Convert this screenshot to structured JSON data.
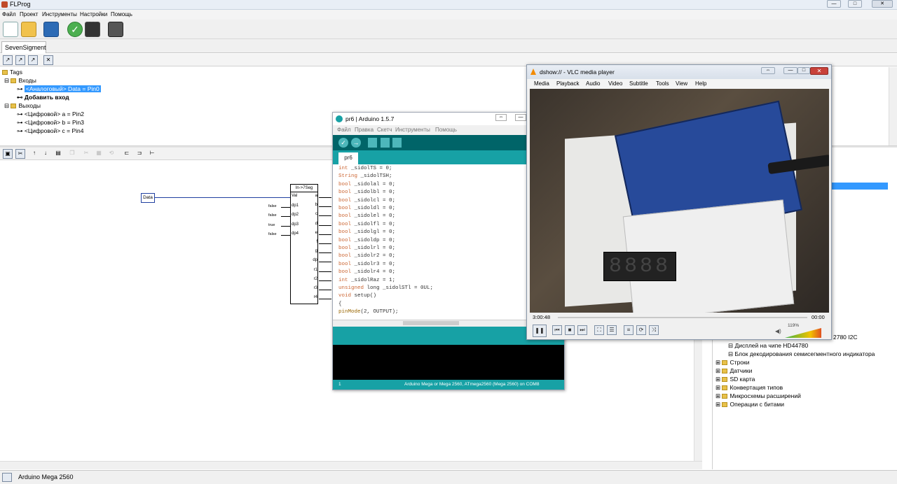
{
  "app": {
    "title": "FLProg",
    "menu": [
      "Файл",
      "Проект",
      "Инструменты",
      "Настройки",
      "Помощь"
    ],
    "tab": "SevenSigment",
    "status": "Arduino Mega 2560"
  },
  "tree": {
    "root": "Tags",
    "inputs_label": "Входы",
    "input_item": "<Аналоговый> Data = Pin0",
    "add_input": "Добавить вход",
    "outputs_label": "Выходы",
    "outputs": [
      "<Цифровой> a = Pin2",
      "<Цифровой> b = Pin3",
      "<Цифровой> c = Pin4"
    ]
  },
  "diagram": {
    "data_block": "Data",
    "block_title": "In->7Seg",
    "left_pins": [
      "Val",
      "dp1",
      "dp2",
      "dp3",
      "dp4"
    ],
    "left_values": [
      "",
      "false",
      "false",
      "true",
      "false"
    ],
    "right_pins": [
      "a",
      "b",
      "c",
      "d",
      "e",
      "f",
      "g",
      "dp",
      "r1",
      "r2",
      "r3",
      "r4"
    ]
  },
  "right_panel": {
    "items": [
      "2780 I2C",
      "Дисплей на чипе HD44780",
      "Блок декодирования семисегментного индикатора",
      "Строки",
      "Датчики",
      "SD карта",
      "Конвертация типов",
      "Микросхемы расширений",
      "Операции с битами"
    ]
  },
  "arduino": {
    "title": "pr6 | Arduino 1.5.7",
    "menu": [
      "Файл",
      "Правка",
      "Скетч",
      "Инструменты",
      "Помощь"
    ],
    "tab": "pr6",
    "code": [
      "int _sidolTS = 0;",
      "String _sidolTSH;",
      "bool _sidolal = 0;",
      "bool _sidolbl = 0;",
      "bool _sidolcl = 0;",
      "bool _sidoldl = 0;",
      "bool _sidolel = 0;",
      "bool _sidolfl = 0;",
      "bool _sidolgl = 0;",
      "bool _sidoldp = 0;",
      "bool _sidolrl = 0;",
      "bool _sidolr2 = 0;",
      "bool _sidolr3 = 0;",
      "bool _sidolr4 = 0;",
      "int _sidolRaz = 1;",
      "unsigned long _sidolSTl = 0UL;",
      "void setup()",
      "{",
      "pinMode(2, OUTPUT);"
    ],
    "line_number": "1",
    "status": "Arduino Mega or Mega 2560, ATmega2560 (Mega 2560) on COM8"
  },
  "vlc": {
    "title": "dshow:// - VLC media player",
    "menu": [
      "Media",
      "Playback",
      "Audio",
      "Video",
      "Subtitle",
      "Tools",
      "View",
      "Help"
    ],
    "time_elapsed": "3:00:48",
    "time_total": "00:00",
    "volume": "119%"
  },
  "colors": {
    "arduino_teal": "#17a1a5",
    "arduino_dark": "#006468",
    "selection": "#3399ff"
  }
}
